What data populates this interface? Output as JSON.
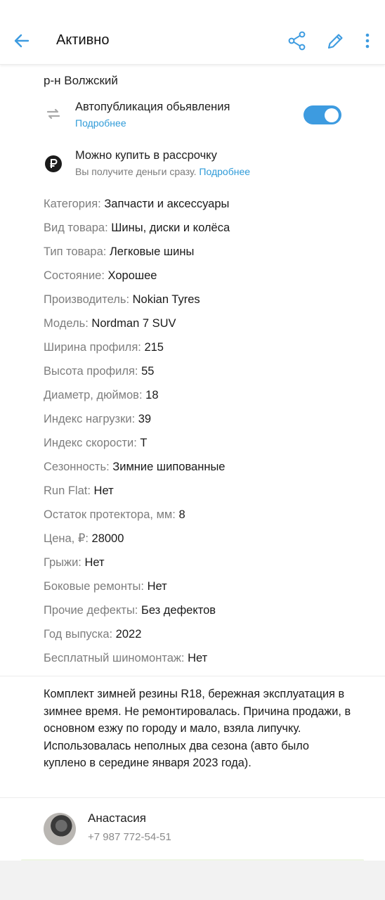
{
  "header": {
    "title": "Активно",
    "icons": [
      "arrow-left-icon",
      "share-icon",
      "pencil-icon",
      "more-vertical-icon"
    ],
    "accent": "#3d9be0"
  },
  "location": "р-н Волжский",
  "autopublish": {
    "title": "Автопубликация обьявления",
    "link": "Подробнее",
    "enabled": true
  },
  "installment": {
    "title": "Можно купить в рассрочку",
    "subtitle": "Вы получите деньги сразу.",
    "link": "Подробнее"
  },
  "params": [
    {
      "key": "Категория:",
      "value": "Запчасти и аксессуары"
    },
    {
      "key": "Вид товара:",
      "value": "Шины, диски и колёса"
    },
    {
      "key": "Тип товара:",
      "value": "Легковые шины"
    },
    {
      "key": "Состояние:",
      "value": "Хорошее"
    },
    {
      "key": "Производитель:",
      "value": "Nokian Tyres"
    },
    {
      "key": "Модель:",
      "value": "Nordman 7 SUV"
    },
    {
      "key": "Ширина профиля:",
      "value": "215"
    },
    {
      "key": "Высота профиля:",
      "value": "55"
    },
    {
      "key": "Диаметр, дюймов:",
      "value": "18"
    },
    {
      "key": "Индекс нагрузки:",
      "value": "39"
    },
    {
      "key": "Индекс скорости:",
      "value": "Т"
    },
    {
      "key": "Сезонность:",
      "value": "Зимние шипованные"
    },
    {
      "key": "Run Flat:",
      "value": "Нет"
    },
    {
      "key": "Остаток протектора, мм:",
      "value": "8"
    },
    {
      "key": "Цена, ₽:",
      "value": "28000"
    },
    {
      "key": "Грыжи:",
      "value": "Нет"
    },
    {
      "key": "Боковые ремонты:",
      "value": "Нет"
    },
    {
      "key": "Прочие дефекты:",
      "value": "Без дефектов"
    },
    {
      "key": "Год выпуска:",
      "value": "2022"
    },
    {
      "key": "Бесплатный шиномонтаж:",
      "value": "Нет"
    }
  ],
  "description": "Комплект зимней резины R18, бережная эксплуатация в зимнее время. Не ремонтировалась. Причина продажи, в основном езжу по городу и мало, взяла липучку. Использовалась неполных два сезона (авто было куплено в середине января 2023 года).",
  "seller": {
    "name": "Анастасия",
    "phone": "+7 987 772-54-51"
  }
}
